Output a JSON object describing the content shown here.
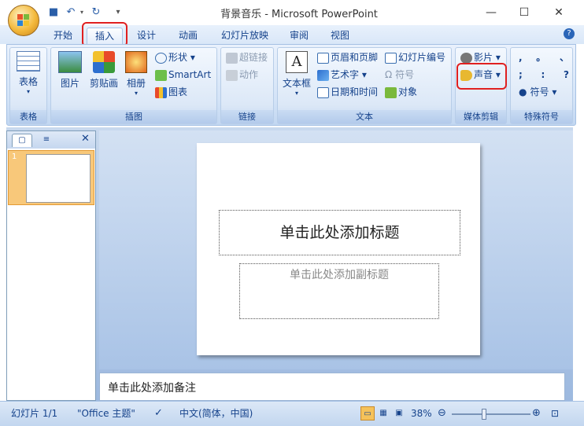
{
  "window": {
    "title": "背景音乐 - Microsoft PowerPoint",
    "minimize": "—",
    "maximize": "☐",
    "close": "✕"
  },
  "tabs": [
    "开始",
    "插入",
    "设计",
    "动画",
    "幻灯片放映",
    "审阅",
    "视图"
  ],
  "active_tab": "插入",
  "ribbon": {
    "table": {
      "label": "表格",
      "group": "表格"
    },
    "illustrations": {
      "picture": "图片",
      "clipart": "剪贴画",
      "album": "相册",
      "shapes": "形状",
      "smartart": "SmartArt",
      "chart": "图表",
      "group": "插图"
    },
    "links": {
      "hyperlink": "超链接",
      "action": "动作",
      "group": "链接"
    },
    "text": {
      "textbox": "文本框",
      "header_footer": "页眉和页脚",
      "wordart": "艺术字",
      "datetime": "日期和时间",
      "slide_number": "幻灯片编号",
      "symbol": "符号",
      "object": "对象",
      "group": "文本"
    },
    "media": {
      "movie": "影片",
      "sound": "声音",
      "group": "媒体剪辑"
    },
    "special": {
      "row1": [
        ",",
        "。",
        "、"
      ],
      "row2": [
        ";",
        ":",
        "?"
      ],
      "symbol": "符号",
      "group": "特殊符号"
    }
  },
  "slide": {
    "title_placeholder": "单击此处添加标题",
    "subtitle_placeholder": "单击此处添加副标题",
    "number": "1"
  },
  "notes": {
    "placeholder": "单击此处添加备注"
  },
  "status": {
    "slide": "幻灯片 1/1",
    "theme": "\"Office 主题\"",
    "language": "中文(简体，中国)",
    "zoom": "38%"
  },
  "colors": {
    "highlight": "#e02020",
    "ribbon_text": "#15428b"
  }
}
